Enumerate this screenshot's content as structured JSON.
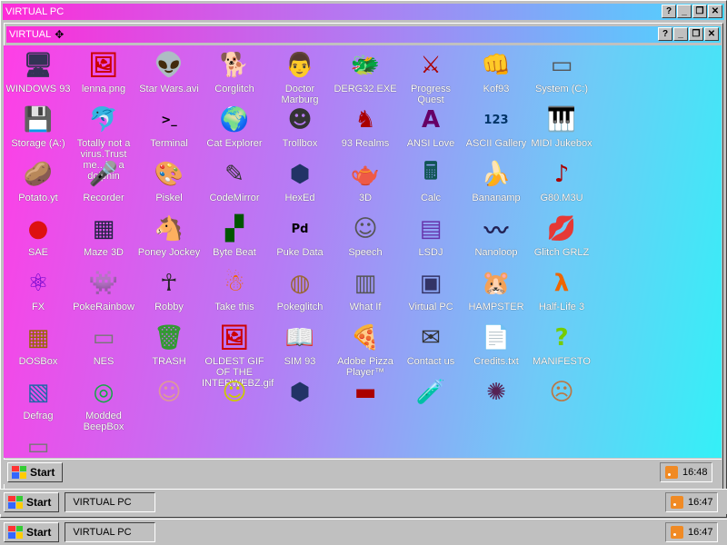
{
  "outer_window": {
    "title": "VIRTUAL PC"
  },
  "inner_window": {
    "title": "VIRTUAL"
  },
  "title_buttons": {
    "help": "?",
    "minimize": "_",
    "restore": "❐",
    "close": "✕"
  },
  "desktop": {
    "icons": [
      {
        "label": "WINDOWS 93",
        "icon": "computer-icon"
      },
      {
        "label": "lenna.png",
        "icon": "image-file-icon"
      },
      {
        "label": "Star Wars.avi",
        "icon": "yoda-icon"
      },
      {
        "label": "Corglitch",
        "icon": "corgi-icon"
      },
      {
        "label": "Doctor Marburg",
        "icon": "doctor-icon"
      },
      {
        "label": "DERG32.EXE",
        "icon": "derg-icon"
      },
      {
        "label": "Progress Quest",
        "icon": "crossed-swords-icon"
      },
      {
        "label": "Kof93",
        "icon": "fighter-face-icon"
      },
      {
        "label": "System (C:)",
        "icon": "drive-icon"
      },
      {
        "label": "Storage (A:)",
        "icon": "floppy-drive-icon"
      },
      {
        "label": "Totally not a virus.Trust me...im a dolphin",
        "icon": "dolphin-icon"
      },
      {
        "label": "Terminal",
        "icon": "terminal-icon"
      },
      {
        "label": "Cat Explorer",
        "icon": "globe-cat-icon"
      },
      {
        "label": "Trollbox",
        "icon": "troll-icon"
      },
      {
        "label": "93 Realms",
        "icon": "knight-icon"
      },
      {
        "label": "ANSI Love",
        "icon": "ansi-book-icon"
      },
      {
        "label": "ASCII Gallery",
        "icon": "numbers-icon"
      },
      {
        "label": "MIDI Jukebox",
        "icon": "piano-icon"
      },
      {
        "label": "Potato.yt",
        "icon": "potato-icon"
      },
      {
        "label": "Recorder",
        "icon": "microphone-icon"
      },
      {
        "label": "Piskel",
        "icon": "palette-icon"
      },
      {
        "label": "CodeMirror",
        "icon": "codemirror-icon"
      },
      {
        "label": "HexEd",
        "icon": "cube-icon"
      },
      {
        "label": "3D",
        "icon": "teapot-icon"
      },
      {
        "label": "Calc",
        "icon": "calculator-icon"
      },
      {
        "label": "Bananamp",
        "icon": "banana-icon"
      },
      {
        "label": "G80.M3U",
        "icon": "audio-file-icon"
      },
      {
        "label": "SAE",
        "icon": "checker-ball-icon"
      },
      {
        "label": "Maze 3D",
        "icon": "maze-icon"
      },
      {
        "label": "Poney Jockey",
        "icon": "pony-icon"
      },
      {
        "label": "Byte Beat",
        "icon": "bytebeat-icon"
      },
      {
        "label": "Puke Data",
        "icon": "pd-icon"
      },
      {
        "label": "Speech",
        "icon": "face-icon"
      },
      {
        "label": "LSDJ",
        "icon": "lsdj-icon"
      },
      {
        "label": "Nanoloop",
        "icon": "wave-icon"
      },
      {
        "label": "Glitch GRLZ",
        "icon": "lips-icon"
      },
      {
        "label": "FX",
        "icon": "atom-icon"
      },
      {
        "label": "PokeRainbow",
        "icon": "pokemon-trainers-icon"
      },
      {
        "label": "Robby",
        "icon": "stick-figure-icon"
      },
      {
        "label": "Take this",
        "icon": "pixel-man-icon"
      },
      {
        "label": "Pokegl⁠itch",
        "icon": "pokeglitch-icon"
      },
      {
        "label": "What If",
        "icon": "whatif-window-icon"
      },
      {
        "label": "Virtual PC",
        "icon": "window-icon"
      },
      {
        "label": "HAMPSTER",
        "icon": "hamster-icon"
      },
      {
        "label": "Half-Life 3",
        "icon": "half-life-icon"
      },
      {
        "label": "DOSBox",
        "icon": "dosbox-icon"
      },
      {
        "label": "NES",
        "icon": "nes-icon"
      },
      {
        "label": "TRASH",
        "icon": "trash-icon"
      },
      {
        "label": "OLDEST GIF OF THE INTERWEBZ.gif",
        "icon": "image-file-icon"
      },
      {
        "label": "SIM 93",
        "icon": "sim-book-icon"
      },
      {
        "label": "Adobe Pizza Player™",
        "icon": "pizza-icon"
      },
      {
        "label": "Contact us",
        "icon": "contact-icon"
      },
      {
        "label": "Credits.txt",
        "icon": "text-file-icon"
      },
      {
        "label": "MANIFESTO",
        "icon": "question-icon"
      },
      {
        "label": "Defrag",
        "icon": "defrag-icon"
      },
      {
        "label": "Modded BeepBox",
        "icon": "beepbox-icon"
      },
      {
        "label": "",
        "icon": "woman-face-icon"
      },
      {
        "label": "",
        "icon": "smiley-icon"
      },
      {
        "label": "",
        "icon": "cube-icon"
      },
      {
        "label": "",
        "icon": "console-icon"
      },
      {
        "label": "",
        "icon": "bottle-icon"
      },
      {
        "label": "",
        "icon": "virus-icon"
      },
      {
        "label": "",
        "icon": "doom-face-icon"
      },
      {
        "label": "",
        "icon": "tape-icon"
      }
    ]
  },
  "taskbars": [
    {
      "start_label": "Start",
      "task_label": "",
      "clock": "16:48"
    },
    {
      "start_label": "Start",
      "task_label": "VIRTUAL PC",
      "clock": "16:47"
    },
    {
      "start_label": "Start",
      "task_label": "VIRTUAL PC",
      "clock": "16:47"
    }
  ],
  "colors": {
    "outer_title_from": "#ff2bd8",
    "outer_title_to": "#4ad8ff",
    "desktop_from": "#ff3ee6",
    "desktop_to": "#34f0f7"
  }
}
